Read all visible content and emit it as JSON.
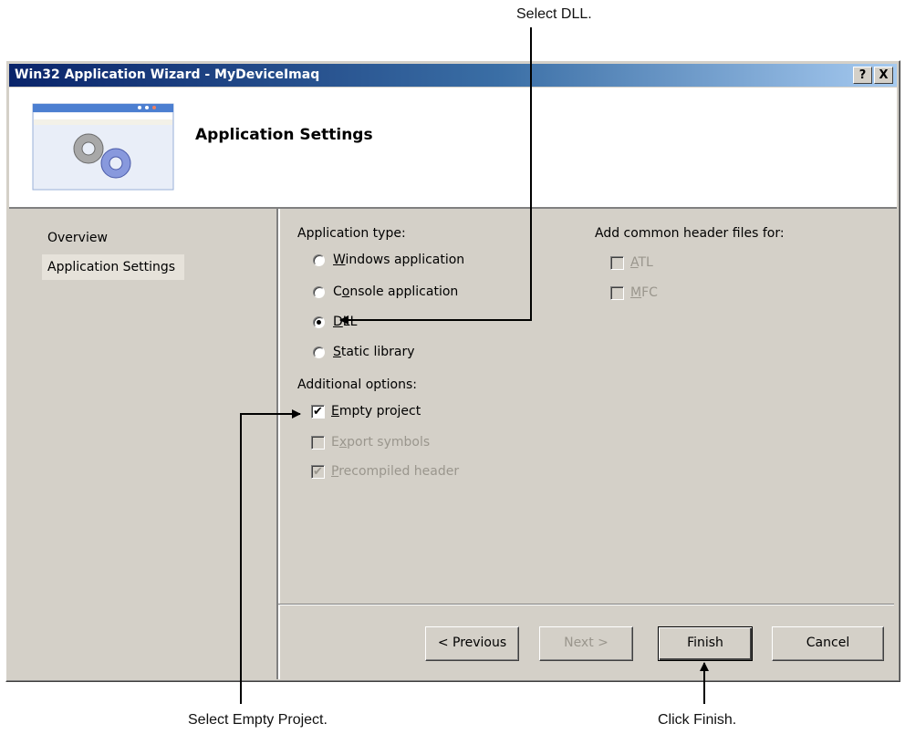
{
  "callouts": {
    "select_dll": "Select DLL.",
    "select_empty": "Select Empty Project.",
    "click_finish": "Click Finish."
  },
  "window": {
    "title": "Win32 Application Wizard - MyDeviceImaq",
    "help_glyph": "?",
    "close_glyph": "X"
  },
  "header": {
    "title": "Application Settings",
    "icon": "gears-window-icon"
  },
  "nav": {
    "items": [
      {
        "label": "Overview"
      },
      {
        "label": "Application Settings",
        "selected": true
      }
    ]
  },
  "app_type": {
    "label": "Application type:",
    "options": [
      {
        "label": "Windows application",
        "mnemonic": "W",
        "rest": "indows application",
        "selected": false
      },
      {
        "label": "Console application",
        "mnemonic_pre": "C",
        "mnemonic": "o",
        "rest": "nsole application",
        "selected": false
      },
      {
        "label": "DLL",
        "mnemonic": "D",
        "rest": "LL",
        "selected": true
      },
      {
        "label": "Static library",
        "mnemonic": "S",
        "rest": "tatic library",
        "selected": false
      }
    ]
  },
  "additional": {
    "label": "Additional options:",
    "options": [
      {
        "label": "Empty project",
        "mnemonic": "E",
        "rest": "mpty project",
        "checked": true,
        "enabled": true
      },
      {
        "label": "Export symbols",
        "mnemonic_pre": "E",
        "mnemonic": "x",
        "rest": "port symbols",
        "checked": false,
        "enabled": false
      },
      {
        "label": "Precompiled header",
        "mnemonic": "P",
        "rest": "recompiled header",
        "checked": true,
        "enabled": false
      }
    ]
  },
  "common_headers": {
    "label": "Add common header files for:",
    "options": [
      {
        "label": "ATL",
        "mnemonic": "A",
        "rest": "TL",
        "checked": false,
        "enabled": false
      },
      {
        "label": "MFC",
        "mnemonic": "M",
        "rest": "FC",
        "checked": false,
        "enabled": false
      }
    ]
  },
  "buttons": {
    "previous": "< Previous",
    "next": "Next >",
    "finish": "Finish",
    "cancel": "Cancel"
  },
  "colors": {
    "titlebar_start": "#0a246a",
    "titlebar_end": "#a6caf0",
    "dialog_bg": "#d4d0c8"
  }
}
